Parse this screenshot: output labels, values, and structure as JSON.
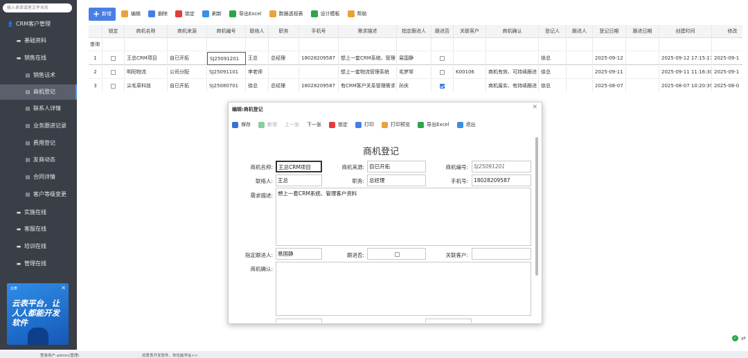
{
  "sidebar": {
    "search_placeholder": "输入表单或者文件关名",
    "items": [
      {
        "label": "CRM客户管理",
        "level": 0,
        "icon": "user-icon"
      },
      {
        "label": "基础资料",
        "level": 1,
        "icon": "folder-icon"
      },
      {
        "label": "销售在线",
        "level": 1,
        "icon": "folder-icon"
      },
      {
        "label": "销售话术",
        "level": 2,
        "icon": "form-icon"
      },
      {
        "label": "商机登记",
        "level": 2,
        "icon": "form-icon",
        "active": true
      },
      {
        "label": "联系人详情",
        "level": 2,
        "icon": "form-icon"
      },
      {
        "label": "业务跟进记录",
        "level": 2,
        "icon": "form-icon"
      },
      {
        "label": "费用登记",
        "level": 2,
        "icon": "form-icon"
      },
      {
        "label": "友商动态",
        "level": 2,
        "icon": "form-icon"
      },
      {
        "label": "合同详情",
        "level": 2,
        "icon": "form-icon"
      },
      {
        "label": "客户等级变更",
        "level": 2,
        "icon": "form-icon"
      },
      {
        "label": "实施在线",
        "level": 1,
        "icon": "folder-icon"
      },
      {
        "label": "客服在线",
        "level": 1,
        "icon": "folder-icon"
      },
      {
        "label": "培训在线",
        "level": 1,
        "icon": "folder-icon"
      },
      {
        "label": "管理在线",
        "level": 1,
        "icon": "folder-icon"
      }
    ],
    "banner": {
      "brand": "云表",
      "slogan": "云表平台，让人人都能开发软件"
    }
  },
  "toolbar": {
    "buttons": [
      {
        "label": "新增",
        "icon": "plus-icon",
        "color": "#4a7ee6"
      },
      {
        "label": "编辑",
        "icon": "edit-icon",
        "color": "#e8a33d"
      },
      {
        "label": "删除",
        "icon": "delete-icon",
        "color": "#4a7ee6"
      },
      {
        "label": "锁定",
        "icon": "lock-icon",
        "color": "#e23c3c"
      },
      {
        "label": "刷新",
        "icon": "refresh-icon",
        "color": "#3b8fe8"
      },
      {
        "label": "导出Excel",
        "icon": "excel-icon",
        "color": "#2da44e"
      },
      {
        "label": "数据透视表",
        "icon": "pivot-icon",
        "color": "#e8a33d"
      },
      {
        "label": "设计模板",
        "icon": "design-icon",
        "color": "#2da44e"
      },
      {
        "label": "帮助",
        "icon": "help-icon",
        "color": "#e8a33d"
      }
    ]
  },
  "table": {
    "filter_label": "查询",
    "headers": [
      "",
      "锁定",
      "商机名称",
      "商机来源",
      "商机编号",
      "联络人",
      "职务",
      "手机号",
      "需求描述",
      "指定跟进人",
      "跟进否",
      "关联客户",
      "商机确认",
      "登记人",
      "跟进人",
      "登记日期",
      "跟进日期",
      "创建时间",
      "修改"
    ],
    "rows": [
      {
        "no": "1",
        "lock": false,
        "name": "王总CRM项目",
        "source": "自已开拓",
        "code": "SJ25091201",
        "contact": "王总",
        "title": "总经理",
        "phone": "18028209587",
        "desc": "想上一套CRM系统、管理",
        "owner": "易国静",
        "follow": false,
        "customer": "",
        "confirm": "",
        "registrar": "徐总",
        "follower": "",
        "reg_date": "2025-09-12",
        "follow_date": "",
        "created": "2025-09-12 17:15:17",
        "modified": "2025-09-1"
      },
      {
        "no": "2",
        "lock": false,
        "name": "明阳物流",
        "source": "公司分配",
        "code": "SJ25091101",
        "contact": "李老师",
        "title": "",
        "phone": "",
        "desc": "想上一套物流管理系统",
        "owner": "毛梦琴",
        "follow": false,
        "customer": "K00106",
        "confirm": "商机有效、可持续跟进",
        "registrar": "徐总",
        "follower": "",
        "reg_date": "2025-09-11",
        "follow_date": "",
        "created": "2025-09-11 11:16:30",
        "modified": "2025-09-1"
      },
      {
        "no": "3",
        "lock": false,
        "name": "尖毛草科技",
        "source": "自已开拓",
        "code": "SJ25080701",
        "contact": "徐总",
        "title": "总经理",
        "phone": "18028209587",
        "desc": "有CRM客户关系管理需求",
        "owner": "孙庆",
        "follow": true,
        "customer": "",
        "confirm": "商机属实、有持续跟进",
        "registrar": "徐总",
        "follower": "",
        "reg_date": "2025-08-07",
        "follow_date": "",
        "created": "2025-08-07 10:20:39",
        "modified": "2025-08-0"
      }
    ]
  },
  "modal": {
    "title": "编辑:商机登记",
    "toolbar": [
      {
        "label": "保存",
        "icon": "save-icon",
        "color": "#3b6fd8"
      },
      {
        "label": "新增",
        "icon": "new-icon",
        "color": "#2da44e",
        "disabled": true
      },
      {
        "label": "上一张",
        "icon": "",
        "color": "",
        "disabled": true
      },
      {
        "label": "下一张",
        "icon": "",
        "color": ""
      },
      {
        "label": "锁定",
        "icon": "lock-icon",
        "color": "#e23c3c"
      },
      {
        "label": "打印",
        "icon": "print-icon",
        "color": "#4a7ee6"
      },
      {
        "label": "打印预览",
        "icon": "print-preview-icon",
        "color": "#e8a33d"
      },
      {
        "label": "导出Excel",
        "icon": "excel-icon",
        "color": "#2da44e"
      },
      {
        "label": "退出",
        "icon": "power-icon",
        "color": "#3b8fe8"
      }
    ],
    "form_title": "商机登记",
    "fields": {
      "name_label": "商机名称:",
      "name": "王总CRM项目",
      "source_label": "商机来源:",
      "source": "自已开拓",
      "code_label": "商机编号:",
      "code": "SJ25091201",
      "contact_label": "联络人:",
      "contact": "王总",
      "title_label": "职务:",
      "title": "总经理",
      "phone_label": "手机号:",
      "phone": "18028209587",
      "desc_label": "需求描述:",
      "desc": "想上一套CRM系统、管理客户资料",
      "owner_label": "指定跟进人:",
      "owner": "易国静",
      "follow_label": "跟进否:",
      "customer_label": "关联客户:",
      "customer": "",
      "confirm_label": "商机确认:",
      "confirm": ""
    }
  },
  "status": {
    "user": "登录用户:admin(管理)",
    "marquee": "如意表开发软件，你也能学会>>"
  },
  "colors": {
    "sidebar_bg": "#3a3e47",
    "accent": "#4a7ee6",
    "page_bg": "#eceef1"
  }
}
